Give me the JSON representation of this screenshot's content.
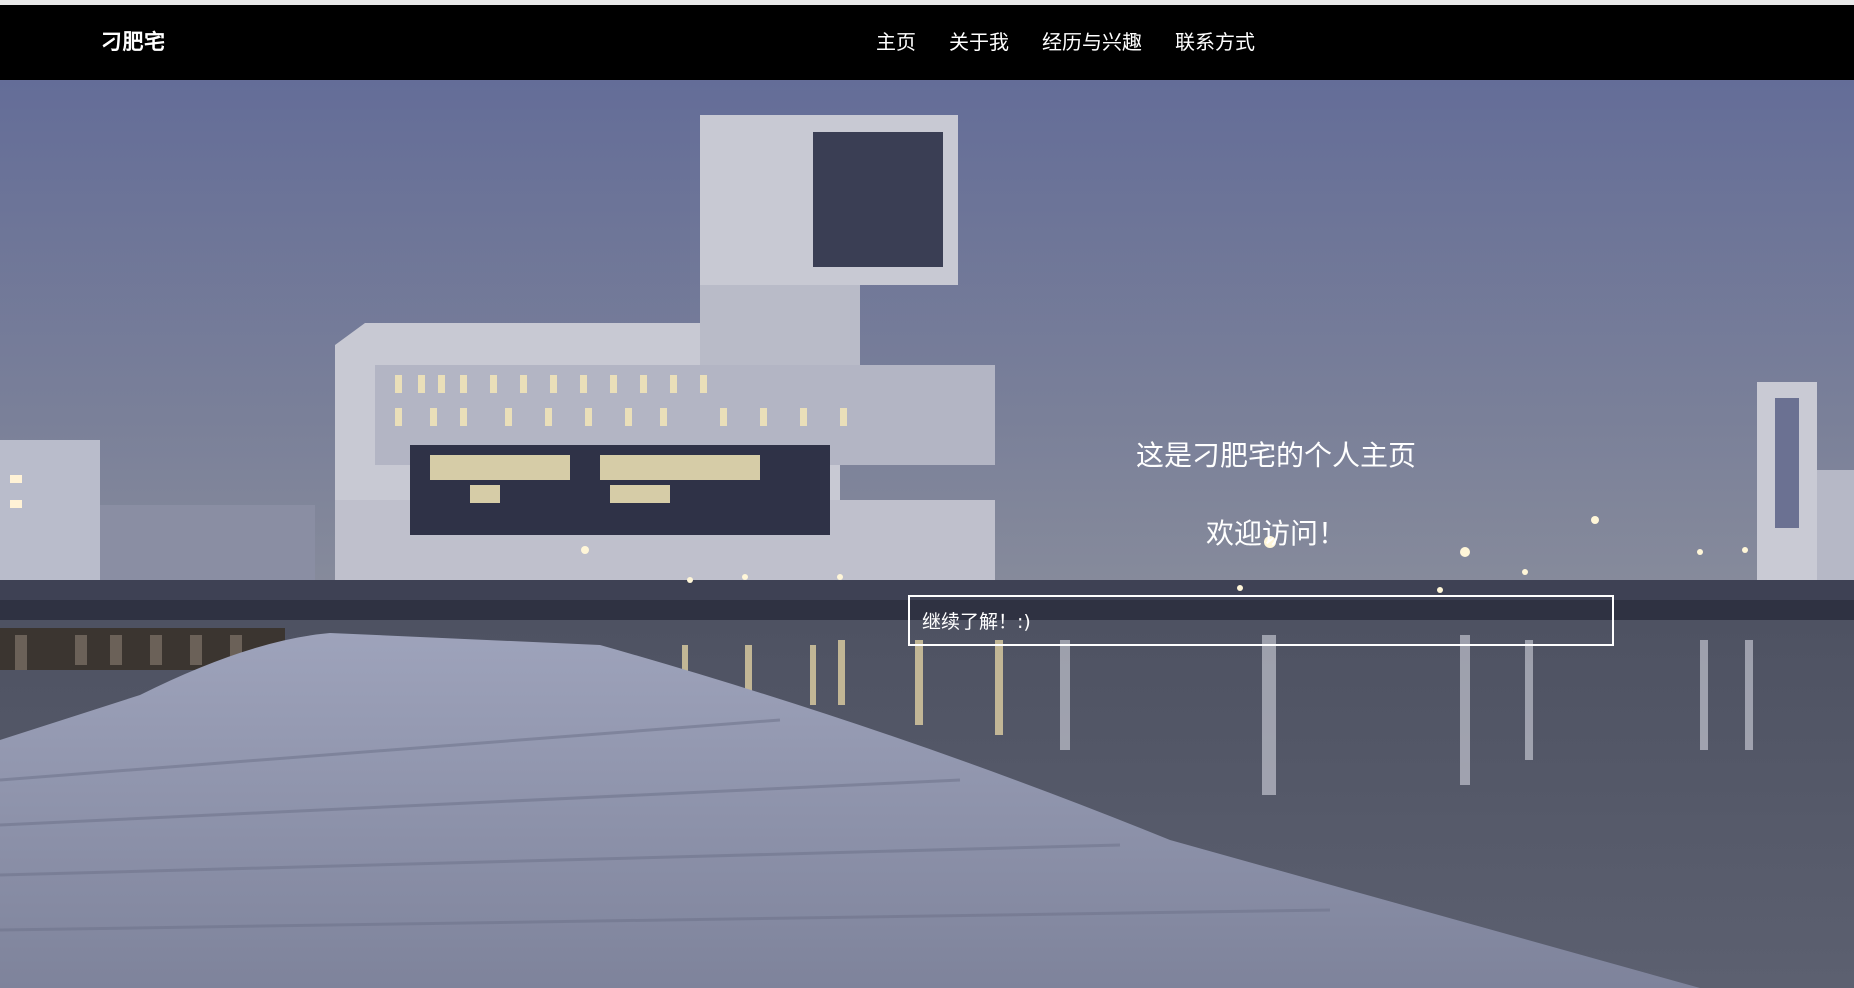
{
  "header": {
    "brand": "刁肥宅",
    "nav": [
      "主页",
      "关于我",
      "经历与兴趣",
      "联系方式"
    ]
  },
  "hero": {
    "title": "这是刁肥宅的个人主页",
    "subtitle": "欢迎访问！",
    "cta_label": "继续了解！:)"
  },
  "colors": {
    "navbar_bg": "#000000",
    "text": "#ffffff",
    "sky": "#6a7398",
    "water": "#555a6a"
  }
}
